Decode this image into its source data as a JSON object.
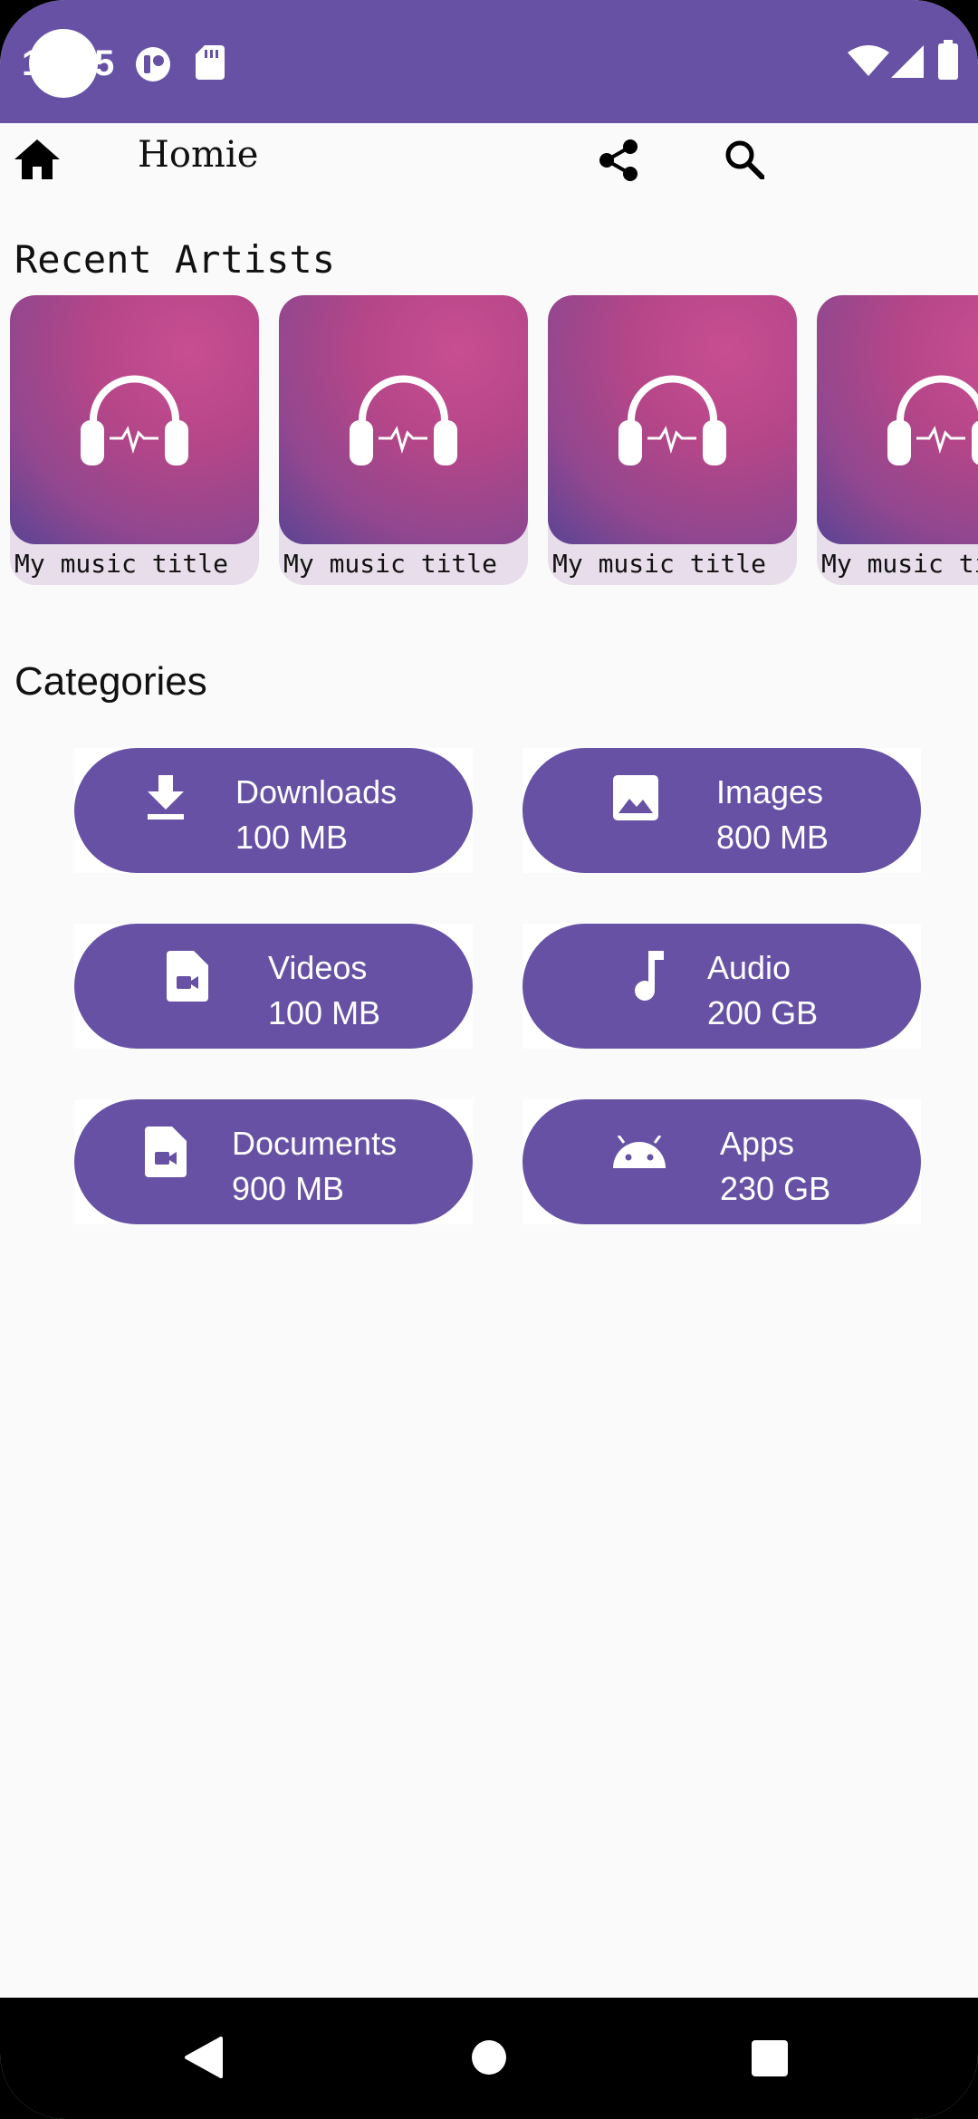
{
  "status_bar": {
    "clock": "12:05",
    "background": "#6751a5",
    "left_icons": [
      "camera-cutout",
      "notification-badge-icon",
      "sd-card-icon"
    ],
    "right_icons": [
      "wifi-icon",
      "signal-icon",
      "battery-icon"
    ]
  },
  "app_bar": {
    "title": "Homie",
    "icons": [
      "home-icon",
      "share-icon",
      "search-icon"
    ]
  },
  "recent_artists": {
    "title": "Recent Artists",
    "items": [
      {
        "caption": "My music title",
        "icon": "headphones-icon"
      },
      {
        "caption": "My music title",
        "icon": "headphones-icon"
      },
      {
        "caption": "My music title",
        "icon": "headphones-icon"
      },
      {
        "caption": "My music title",
        "icon": "headphones-icon"
      }
    ]
  },
  "categories": {
    "title": "Categories",
    "accent": "#6751a5",
    "items": [
      {
        "label": "Downloads",
        "size": "100 MB",
        "icon": "download-icon"
      },
      {
        "label": "Images",
        "size": "800 MB",
        "icon": "image-icon"
      },
      {
        "label": "Videos",
        "size": "100 MB",
        "icon": "video-file-icon"
      },
      {
        "label": "Audio",
        "size": "200 GB",
        "icon": "music-note-icon"
      },
      {
        "label": "Documents",
        "size": "900 MB",
        "icon": "document-icon"
      },
      {
        "label": "Apps",
        "size": "230 GB",
        "icon": "android-icon"
      }
    ]
  },
  "nav_bar": {
    "buttons": [
      "back-icon",
      "home-circle-icon",
      "recents-icon"
    ]
  }
}
